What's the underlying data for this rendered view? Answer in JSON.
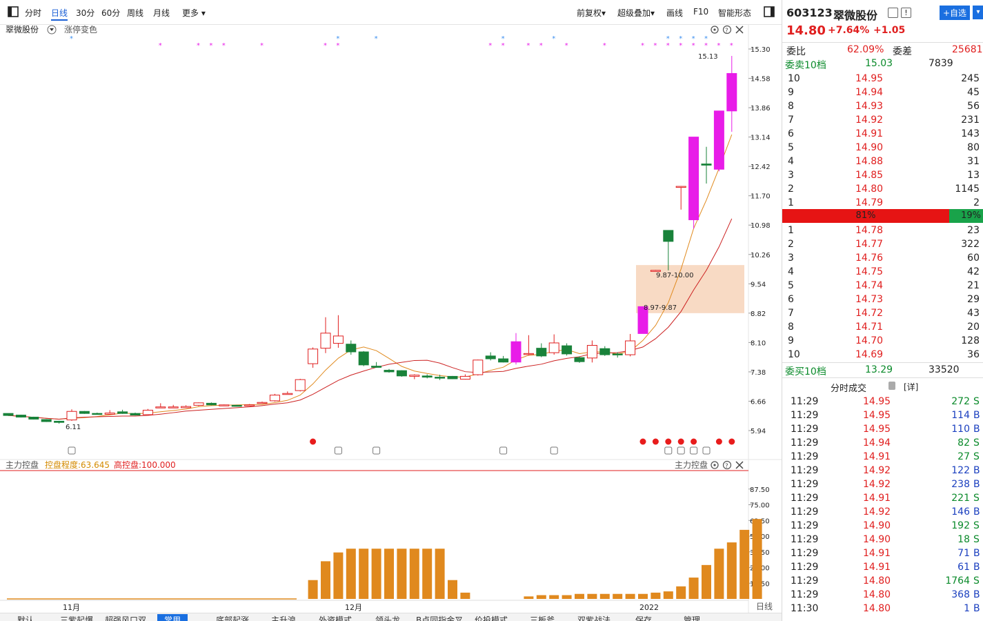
{
  "toolbar": {
    "tabs": [
      "分时",
      "日线",
      "30分",
      "60分",
      "周线",
      "月线",
      "更多 ▾"
    ],
    "active_tab": "日线",
    "right_items": [
      "前复权▾",
      "超级叠加▾",
      "画线",
      "F10",
      "智能形态"
    ]
  },
  "main_chart": {
    "stock_label": "翠微股份",
    "overlay_label": "涨停变色",
    "price_ticks": [
      "15.30",
      "14.58",
      "13.86",
      "13.14",
      "12.42",
      "11.70",
      "10.98",
      "10.26",
      "9.54",
      "8.82",
      "8.10",
      "7.38",
      "6.66",
      "5.94"
    ],
    "annotations": {
      "high": "15.13",
      "low": "6.11",
      "zone_upper": "9.87-10.00",
      "zone_lower": "8.97-9.87"
    }
  },
  "sub_chart": {
    "title": "主力控盘",
    "degree_label": "控盘程度:63.645",
    "high_label": "高控盘:100.000",
    "right_title": "主力控盘",
    "y_ticks": [
      "87.50",
      "75.00",
      "62.50",
      "50.00",
      "37.50",
      "25.00",
      "12.50"
    ]
  },
  "x_axis": {
    "labels": [
      "11月",
      "12月",
      "2022"
    ],
    "period_label": "日线"
  },
  "bottom_tabs": {
    "items": [
      "默认",
      "三紫起爆",
      "超强风口双",
      "常用",
      "底部起涨",
      "主升浪",
      "外资模式",
      "领头龙",
      "B点同指金叉",
      "价投模式",
      "三板斧",
      "双紫战法",
      "保存",
      "管理"
    ],
    "active": "常用"
  },
  "quote": {
    "code": "603123",
    "name": "翠微股份",
    "add_button": "+自选",
    "price": "14.80",
    "change_pct": "+7.64%",
    "change": "+1.05",
    "ratio_label": "委比",
    "ratio": "62.09%",
    "diff_label": "委差",
    "diff": "25681",
    "sell_header": "委卖10档",
    "sell_header_price": "15.03",
    "sell_header_vol": "7839",
    "sell": [
      {
        "level": "10",
        "price": "14.95",
        "vol": "245"
      },
      {
        "level": "9",
        "price": "14.94",
        "vol": "45"
      },
      {
        "level": "8",
        "price": "14.93",
        "vol": "56"
      },
      {
        "level": "7",
        "price": "14.92",
        "vol": "231"
      },
      {
        "level": "6",
        "price": "14.91",
        "vol": "143"
      },
      {
        "level": "5",
        "price": "14.90",
        "vol": "80"
      },
      {
        "level": "4",
        "price": "14.88",
        "vol": "31"
      },
      {
        "level": "3",
        "price": "14.85",
        "vol": "13"
      },
      {
        "level": "2",
        "price": "14.80",
        "vol": "1145"
      },
      {
        "level": "1",
        "price": "14.79",
        "vol": "2"
      }
    ],
    "buy_strength": "81%",
    "sell_strength": "19%",
    "buy": [
      {
        "level": "1",
        "price": "14.78",
        "vol": "23"
      },
      {
        "level": "2",
        "price": "14.77",
        "vol": "322"
      },
      {
        "level": "3",
        "price": "14.76",
        "vol": "60"
      },
      {
        "level": "4",
        "price": "14.75",
        "vol": "42"
      },
      {
        "level": "5",
        "price": "14.74",
        "vol": "21"
      },
      {
        "level": "6",
        "price": "14.73",
        "vol": "29"
      },
      {
        "level": "7",
        "price": "14.72",
        "vol": "43"
      },
      {
        "level": "8",
        "price": "14.71",
        "vol": "20"
      },
      {
        "level": "9",
        "price": "14.70",
        "vol": "128"
      },
      {
        "level": "10",
        "price": "14.69",
        "vol": "36"
      }
    ],
    "buy_header": "委买10档",
    "buy_header_price": "13.29",
    "buy_header_vol": "33520",
    "trades_title": "分时成交",
    "trades_detail": "[详]",
    "trades": [
      {
        "time": "11:29",
        "price": "14.95",
        "vol": "272",
        "side": "S"
      },
      {
        "time": "11:29",
        "price": "14.95",
        "vol": "114",
        "side": "B"
      },
      {
        "time": "11:29",
        "price": "14.95",
        "vol": "110",
        "side": "B"
      },
      {
        "time": "11:29",
        "price": "14.94",
        "vol": "82",
        "side": "S"
      },
      {
        "time": "11:29",
        "price": "14.91",
        "vol": "27",
        "side": "S"
      },
      {
        "time": "11:29",
        "price": "14.92",
        "vol": "122",
        "side": "B"
      },
      {
        "time": "11:29",
        "price": "14.92",
        "vol": "238",
        "side": "B"
      },
      {
        "time": "11:29",
        "price": "14.91",
        "vol": "221",
        "side": "S"
      },
      {
        "time": "11:29",
        "price": "14.92",
        "vol": "146",
        "side": "B"
      },
      {
        "time": "11:29",
        "price": "14.90",
        "vol": "192",
        "side": "S"
      },
      {
        "time": "11:29",
        "price": "14.90",
        "vol": "18",
        "side": "S"
      },
      {
        "time": "11:29",
        "price": "14.91",
        "vol": "71",
        "side": "B"
      },
      {
        "time": "11:29",
        "price": "14.91",
        "vol": "61",
        "side": "B"
      },
      {
        "time": "11:29",
        "price": "14.80",
        "vol": "1764",
        "side": "S"
      },
      {
        "time": "11:29",
        "price": "14.80",
        "vol": "368",
        "side": "B"
      },
      {
        "time": "11:30",
        "price": "14.80",
        "vol": "1",
        "side": "B"
      }
    ]
  },
  "chart_data": {
    "type": "candlestick",
    "price_range": [
      5.94,
      15.3
    ],
    "candles": [
      [
        6.36,
        6.31,
        6.35,
        6.3
      ],
      [
        6.32,
        6.27,
        6.33,
        6.26
      ],
      [
        6.27,
        6.22,
        6.28,
        6.21
      ],
      [
        6.21,
        6.16,
        6.22,
        6.15
      ],
      [
        6.17,
        6.14,
        6.18,
        6.11
      ],
      [
        6.2,
        6.41,
        6.46,
        6.18
      ],
      [
        6.41,
        6.36,
        6.42,
        6.35
      ],
      [
        6.36,
        6.35,
        6.38,
        6.34
      ],
      [
        6.34,
        6.37,
        6.44,
        6.33
      ],
      [
        6.4,
        6.36,
        6.45,
        6.35
      ],
      [
        6.36,
        6.32,
        6.38,
        6.31
      ],
      [
        6.33,
        6.44,
        6.47,
        6.32
      ],
      [
        6.51,
        6.52,
        6.61,
        6.49
      ],
      [
        6.5,
        6.52,
        6.57,
        6.49
      ],
      [
        6.5,
        6.53,
        6.56,
        6.49
      ],
      [
        6.56,
        6.62,
        6.63,
        6.54
      ],
      [
        6.61,
        6.57,
        6.63,
        6.56
      ],
      [
        6.57,
        6.57,
        6.58,
        6.55
      ],
      [
        6.56,
        6.55,
        6.57,
        6.54
      ],
      [
        6.56,
        6.57,
        6.59,
        6.55
      ],
      [
        6.61,
        6.63,
        6.65,
        6.6
      ],
      [
        6.67,
        6.81,
        6.84,
        6.65
      ],
      [
        6.84,
        6.85,
        6.9,
        6.82
      ],
      [
        6.92,
        7.19,
        7.21,
        6.9
      ],
      [
        7.58,
        7.94,
        7.98,
        7.48
      ],
      [
        7.96,
        8.33,
        8.72,
        7.84
      ],
      [
        8.08,
        8.26,
        8.77,
        7.97
      ],
      [
        8.06,
        7.87,
        8.15,
        7.8
      ],
      [
        7.87,
        7.55,
        7.89,
        7.52
      ],
      [
        7.52,
        7.49,
        7.62,
        7.48
      ],
      [
        7.42,
        7.38,
        7.45,
        7.36
      ],
      [
        7.41,
        7.28,
        7.42,
        7.26
      ],
      [
        7.27,
        7.3,
        7.32,
        7.2
      ],
      [
        7.28,
        7.25,
        7.32,
        7.22
      ],
      [
        7.25,
        7.24,
        7.31,
        7.18
      ],
      [
        7.27,
        7.21,
        7.28,
        7.2
      ],
      [
        7.2,
        7.27,
        7.32,
        7.19
      ],
      [
        7.31,
        7.67,
        7.68,
        7.29
      ],
      [
        7.77,
        7.7,
        7.86,
        7.66
      ],
      [
        7.7,
        7.62,
        7.77,
        7.61
      ],
      [
        7.62,
        8.12,
        8.33,
        7.56
      ],
      [
        7.82,
        7.83,
        8.28,
        7.78
      ],
      [
        7.96,
        7.77,
        8.08,
        7.74
      ],
      [
        7.85,
        8.09,
        8.3,
        7.8
      ],
      [
        8.02,
        7.82,
        8.08,
        7.78
      ],
      [
        7.73,
        7.63,
        7.76,
        7.6
      ],
      [
        7.72,
        8.03,
        8.15,
        7.61
      ],
      [
        7.95,
        7.8,
        8.01,
        7.77
      ],
      [
        7.82,
        7.81,
        7.86,
        7.73
      ],
      [
        7.8,
        8.14,
        8.31,
        7.76
      ],
      [
        8.32,
        8.98,
        8.98,
        8.32
      ],
      [
        9.87,
        9.87,
        9.88,
        9.86
      ],
      [
        10.85,
        10.58,
        10.85,
        9.87
      ],
      [
        11.93,
        11.93,
        11.94,
        11.36
      ],
      [
        11.11,
        13.14,
        13.14,
        10.89
      ],
      [
        12.48,
        12.45,
        12.9,
        12.0
      ],
      [
        12.35,
        13.78,
        13.78,
        12.3
      ],
      [
        13.78,
        14.7,
        15.13,
        13.27
      ]
    ]
  }
}
